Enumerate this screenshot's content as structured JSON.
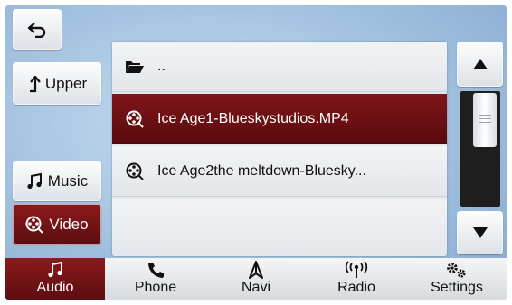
{
  "left_panel": {
    "back_icon": "back-arrow-icon",
    "upper_label": "Upper",
    "music_label": "Music",
    "video_label": "Video"
  },
  "file_list": {
    "items": [
      {
        "icon": "folder-open-icon",
        "label": ".."
      },
      {
        "icon": "film-reel-icon",
        "label": "Ice Age1-Blueskystudios.MP4",
        "selected": true
      },
      {
        "icon": "film-reel-icon",
        "label": "Ice Age2the meltdown-Bluesky..."
      },
      {
        "icon": "",
        "label": ""
      }
    ]
  },
  "scroll": {
    "up_icon": "triangle-up-icon",
    "down_icon": "triangle-down-icon"
  },
  "bottom_nav": {
    "tabs": [
      {
        "icon": "music-note-icon",
        "label": "Audio",
        "active": true
      },
      {
        "icon": "phone-icon",
        "label": "Phone"
      },
      {
        "icon": "navigation-arrow-icon",
        "label": "Navi"
      },
      {
        "icon": "radio-antenna-icon",
        "label": "Radio"
      },
      {
        "icon": "gears-icon",
        "label": "Settings"
      }
    ]
  },
  "colors": {
    "accent": "#7e1518",
    "background": "#a7c5e2"
  }
}
